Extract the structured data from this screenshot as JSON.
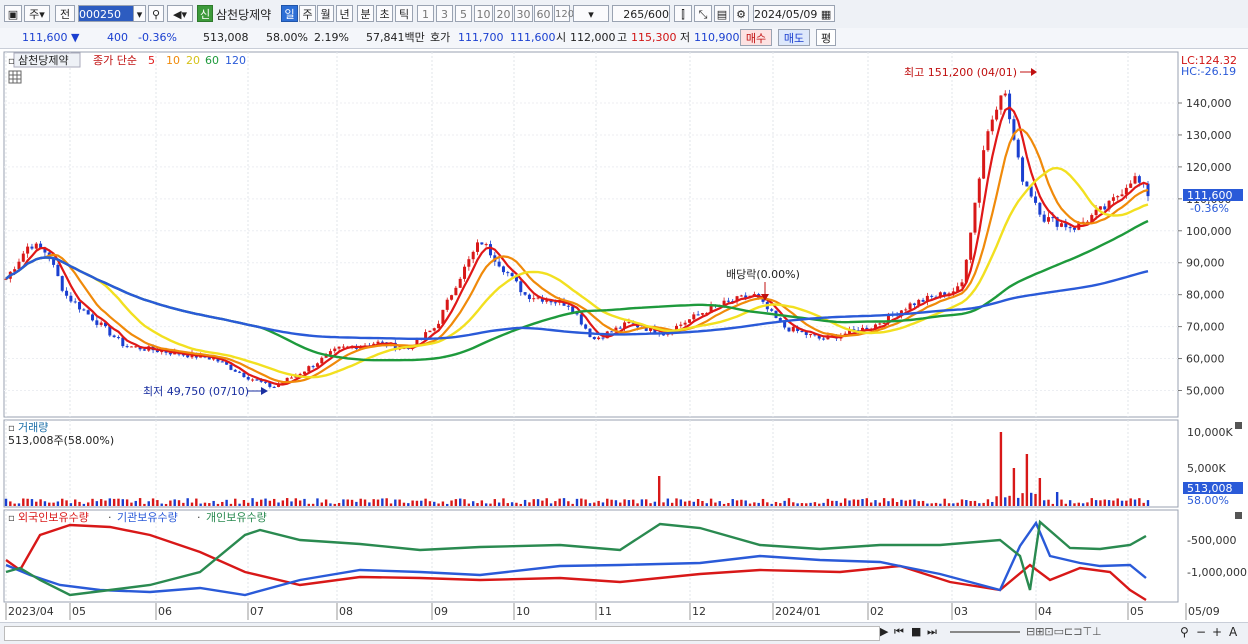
{
  "toolbar": {
    "market": "주",
    "prev": "전",
    "code": "000250",
    "new_badge": "신",
    "stock_name": "삼천당제약",
    "periods": [
      "일",
      "주",
      "월",
      "년",
      "분",
      "초",
      "틱"
    ],
    "intervals": [
      "1",
      "3",
      "5",
      "10",
      "20",
      "30",
      "60",
      "120"
    ],
    "count": "265",
    "count_total": "/600",
    "date": "2024/05/09"
  },
  "quote": {
    "price": "111,600",
    "change": "400",
    "change_pct": "-0.36%",
    "volume": "513,008",
    "volume_ratio": "58.00%",
    "turnover": "2.19%",
    "amount": "57,841백만",
    "ask_label": "호가",
    "ask": "111,700",
    "bid": "111,600",
    "open_label": "시",
    "open": "112,000",
    "high_label": "고",
    "high": "115,300",
    "low_label": "저",
    "low": "110,900",
    "buy_label": "매수",
    "sell_label": "매도",
    "eval_label": "평"
  },
  "price_panel": {
    "name_tag": "삼천당제약",
    "ma_title": "종가 단순",
    "ma_periods": [
      "5",
      "10",
      "20",
      "60",
      "120"
    ],
    "ma_colors": [
      "#e01818",
      "#f08a0a",
      "#f2e020",
      "#1e9a3c",
      "#2a5ad8"
    ],
    "lc": "LC:124.32",
    "hc": "HC:-26.19",
    "high_note": "최고 151,200 (04/01)",
    "low_note": "최저 49,750 (07/10)",
    "dividend_note": "배당락(0.00%)",
    "current_price_label": "111,600",
    "current_pct_label": "-0.36%",
    "y_ticks": [
      "140,000",
      "130,000",
      "120,000",
      "110,000",
      "100,000",
      "90,000",
      "80,000",
      "70,000",
      "60,000",
      "50,000"
    ]
  },
  "volume_panel": {
    "title": "거래량",
    "value": "513,008주(58.00%)",
    "y_ticks": [
      "10,000K",
      "5,000K"
    ],
    "current_label": "513,008",
    "current_pct": "58.00%"
  },
  "holding_panel": {
    "series": [
      "외국인보유수량",
      "기관보유수량",
      "개인보유수량"
    ],
    "colors": [
      "#d81818",
      "#2a5ad8",
      "#2a8a50"
    ],
    "y_ticks": [
      "-500,000",
      "-1,000,000"
    ]
  },
  "x_axis": {
    "labels": [
      "2023/04",
      "05",
      "06",
      "07",
      "08",
      "09",
      "10",
      "11",
      "12",
      "2024/01",
      "02",
      "03",
      "04",
      "05",
      "05/09"
    ]
  }
}
